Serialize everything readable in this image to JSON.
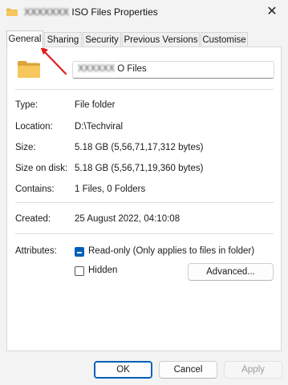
{
  "window": {
    "title_blurred": "XXXXXXX",
    "title_suffix": "ISO Files Properties",
    "close_glyph": "✕"
  },
  "tabs": [
    {
      "label": "General",
      "active": true
    },
    {
      "label": "Sharing"
    },
    {
      "label": "Security"
    },
    {
      "label": "Previous Versions"
    },
    {
      "label": "Customise"
    }
  ],
  "general": {
    "name_blurred": "XXXXXX",
    "name_suffix": "O Files",
    "rows": [
      {
        "label": "Type:",
        "value": "File folder"
      },
      {
        "label": "Location:",
        "value": "D:\\Techviral"
      },
      {
        "label": "Size:",
        "value": "5.18 GB (5,56,71,17,312 bytes)"
      },
      {
        "label": "Size on disk:",
        "value": "5.18 GB (5,56,71,19,360 bytes)"
      },
      {
        "label": "Contains:",
        "value": "1 Files, 0 Folders"
      }
    ],
    "created": {
      "label": "Created:",
      "value": "25 August 2022, 04:10:08"
    },
    "attributes": {
      "label": "Attributes:",
      "read_only": {
        "label": "Read-only (Only applies to files in folder)",
        "checked": "indeterminate"
      },
      "hidden": {
        "label": "Hidden",
        "checked": false
      },
      "advanced_button": "Advanced..."
    }
  },
  "footer": {
    "ok": "OK",
    "cancel": "Cancel",
    "apply": "Apply"
  },
  "colors": {
    "accent": "#005fb8",
    "annotation_arrow": "#e02020"
  },
  "icons": [
    "folder-icon",
    "close-icon",
    "arrow-annotation"
  ]
}
